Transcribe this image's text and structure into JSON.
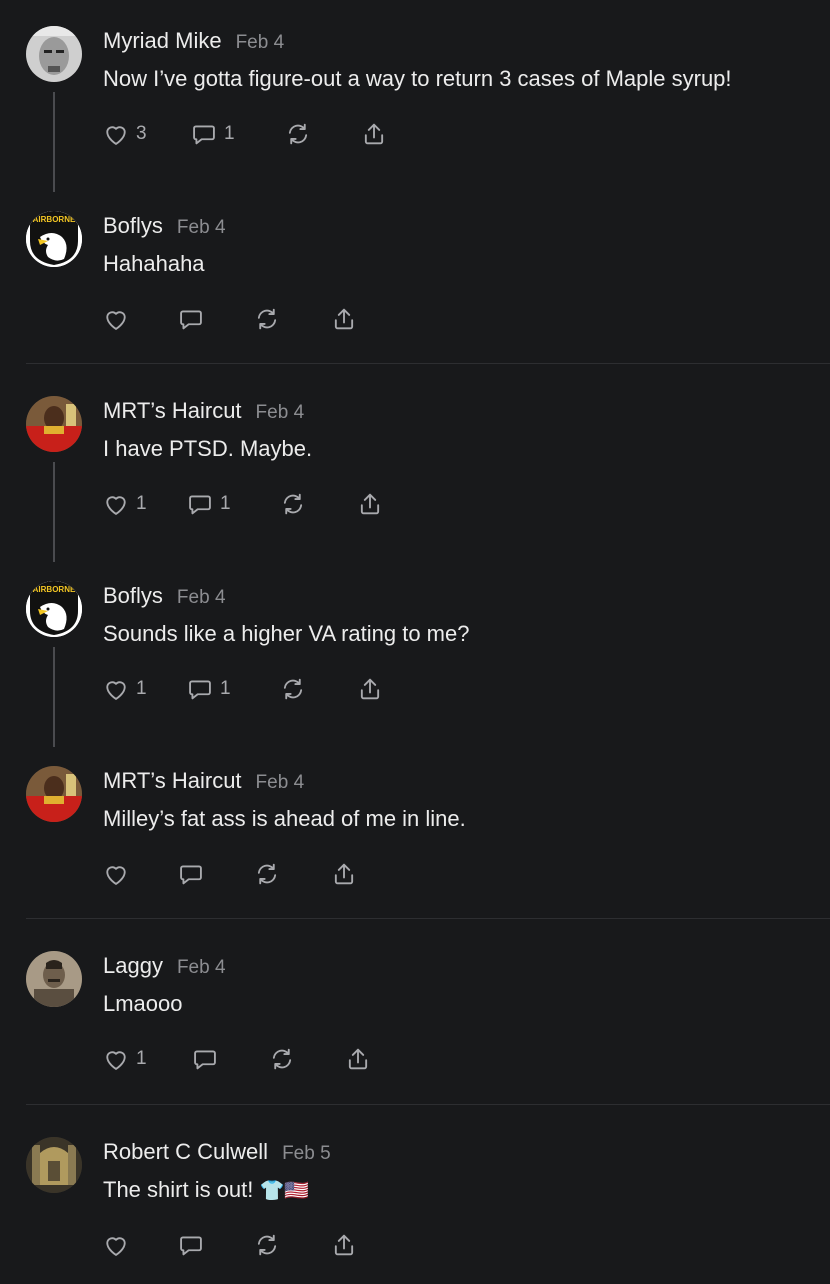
{
  "comments": [
    {
      "author": "Myriad Mike",
      "date": "Feb 4",
      "text": "Now I’ve gotta figure-out a way to return 3 cases of Maple syrup!",
      "likes": "3",
      "replies": "1"
    },
    {
      "author": "Boflys",
      "date": "Feb 4",
      "text": "Hahahaha",
      "likes": "",
      "replies": ""
    },
    {
      "author": "MRT’s Haircut",
      "date": "Feb 4",
      "text": "I have PTSD. Maybe.",
      "likes": "1",
      "replies": "1"
    },
    {
      "author": "Boflys",
      "date": "Feb 4",
      "text": "Sounds like a higher VA rating to me?",
      "likes": "1",
      "replies": "1"
    },
    {
      "author": "MRT’s Haircut",
      "date": "Feb 4",
      "text": "Milley’s fat ass is ahead of me in line.",
      "likes": "",
      "replies": ""
    },
    {
      "author": "Laggy",
      "date": "Feb 4",
      "text": "Lmaooo",
      "likes": "1",
      "replies": ""
    },
    {
      "author": "Robert C Culwell",
      "date": "Feb 5",
      "text": "The shirt is out!",
      "emoji": "👕🇺🇸",
      "likes": "",
      "replies": ""
    }
  ],
  "avatar_text": {
    "airborne": "AIRBORNE"
  },
  "icons": {
    "like": "heart-icon",
    "reply": "comment-icon",
    "restack": "restack-icon",
    "share": "share-icon"
  },
  "colors": {
    "background": "#18191b",
    "text": "#ececec",
    "muted": "#8c8d91",
    "icon": "#a9aaae",
    "thread_line": "#4a4b4f",
    "divider": "#2d2e31"
  }
}
